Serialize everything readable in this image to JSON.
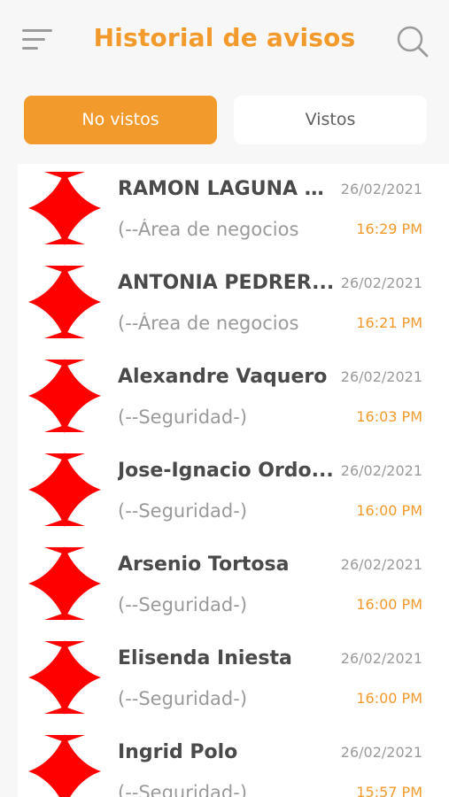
{
  "header": {
    "title": "Historial de avisos",
    "menu_icon": "hamburger-menu-icon",
    "search_icon": "search-icon"
  },
  "tabs": [
    {
      "label": "No vistos",
      "active": true
    },
    {
      "label": "Vistos",
      "active": false
    }
  ],
  "colors": {
    "accent": "#f39a2c",
    "avatar": "#ff0000",
    "name_text": "#4a4a4a",
    "muted_text": "#9a9a9a"
  },
  "notices": [
    {
      "name": "RAMON LAGUNA S...",
      "subtitle": "(--Área de negocios",
      "date": "26/02/2021",
      "time": "16:29 PM"
    },
    {
      "name": "ANTONIA PEDRER...",
      "subtitle": "(--Área de negocios",
      "date": "26/02/2021",
      "time": "16:21 PM"
    },
    {
      "name": "Alexandre Vaquero",
      "subtitle": "(--Seguridad-)",
      "date": "26/02/2021",
      "time": "16:03 PM"
    },
    {
      "name": "Jose-Ignacio Ordo...",
      "subtitle": "(--Seguridad-)",
      "date": "26/02/2021",
      "time": "16:00 PM"
    },
    {
      "name": "Arsenio Tortosa",
      "subtitle": "(--Seguridad-)",
      "date": "26/02/2021",
      "time": "16:00 PM"
    },
    {
      "name": "Elisenda Iniesta",
      "subtitle": "(--Seguridad-)",
      "date": "26/02/2021",
      "time": "16:00 PM"
    },
    {
      "name": "Ingrid Polo",
      "subtitle": "(--Seguridad-)",
      "date": "26/02/2021",
      "time": "15:57 PM"
    }
  ]
}
